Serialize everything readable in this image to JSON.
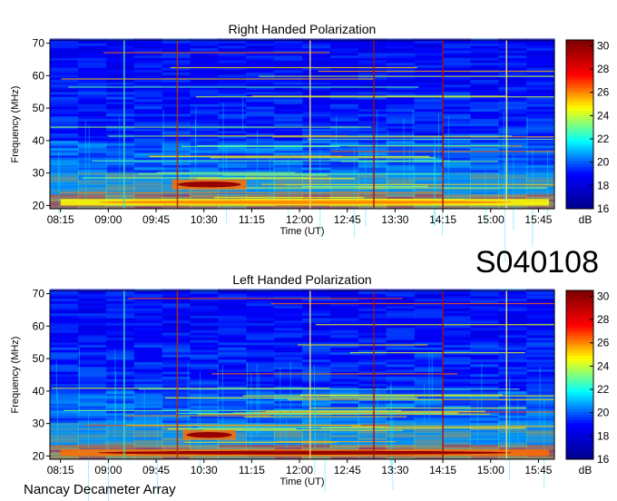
{
  "observation_id": "S040108",
  "instrument": "Nancay Decameter Array",
  "chart_data": [
    {
      "type": "heatmap",
      "title": "Right Handed Polarization",
      "xlabel": "Time (UT)",
      "ylabel": "Frequency (MHz)",
      "x_ticks": [
        "08:15",
        "09:00",
        "09:45",
        "10:30",
        "11:15",
        "12:00",
        "12:45",
        "13:30",
        "14:15",
        "15:00",
        "15:45"
      ],
      "y_ticks": [
        20,
        30,
        40,
        50,
        60,
        70
      ],
      "ylim": [
        19,
        71
      ],
      "colorbar": {
        "label": "dB",
        "ticks": [
          16,
          18,
          20,
          22,
          24,
          26,
          28,
          30
        ],
        "range": [
          16,
          30.5
        ]
      },
      "colormap": [
        "#00008f",
        "#0000ff",
        "#00ffff",
        "#ffff00",
        "#ff0000",
        "#800000"
      ],
      "notable_features": [
        {
          "feature": "intense burst",
          "time_start": "10:00",
          "time_end": "11:10",
          "freq_range_mhz": [
            25,
            28
          ],
          "level_db": 30
        },
        {
          "feature": "bright band",
          "time_start": "08:15",
          "time_end": "15:55",
          "freq_range_mhz": [
            20,
            22
          ],
          "level_db": 26
        }
      ],
      "vertical_lines": [
        {
          "time": "09:15",
          "color": "#40e0b0"
        },
        {
          "time": "10:05",
          "color": "#b03000"
        },
        {
          "time": "12:10",
          "color": "#e8d070"
        },
        {
          "time": "13:10",
          "color": "#a01010"
        },
        {
          "time": "14:15",
          "color": "#a01010"
        },
        {
          "time": "15:15",
          "color": "#e8e070"
        }
      ]
    },
    {
      "type": "heatmap",
      "title": "Left Handed Polarization",
      "xlabel": "Time (UT)",
      "ylabel": "Frequency (MHz)",
      "x_ticks": [
        "08:15",
        "09:00",
        "09:45",
        "10:30",
        "11:15",
        "12:00",
        "12:45",
        "13:30",
        "14:15",
        "15:00",
        "15:45"
      ],
      "y_ticks": [
        20,
        30,
        40,
        50,
        60,
        70
      ],
      "ylim": [
        19,
        71
      ],
      "colorbar": {
        "label": "dB",
        "ticks": [
          16,
          18,
          20,
          22,
          24,
          26,
          28,
          30
        ],
        "range": [
          16,
          30.5
        ]
      },
      "colormap": [
        "#00008f",
        "#0000ff",
        "#00ffff",
        "#ffff00",
        "#ff0000",
        "#800000"
      ],
      "notable_features": [
        {
          "feature": "intense burst",
          "time_start": "10:10",
          "time_end": "11:00",
          "freq_range_mhz": [
            25,
            28
          ],
          "level_db": 30
        },
        {
          "feature": "bright band",
          "time_start": "08:15",
          "time_end": "15:55",
          "freq_range_mhz": [
            20,
            22
          ],
          "level_db": 30
        }
      ],
      "vertical_lines": [
        {
          "time": "09:15",
          "color": "#40e0b0"
        },
        {
          "time": "10:05",
          "color": "#b03000"
        },
        {
          "time": "12:10",
          "color": "#e8d070"
        },
        {
          "time": "13:10",
          "color": "#a01010"
        },
        {
          "time": "14:15",
          "color": "#a01010"
        },
        {
          "time": "15:15",
          "color": "#e8e070"
        }
      ]
    }
  ]
}
